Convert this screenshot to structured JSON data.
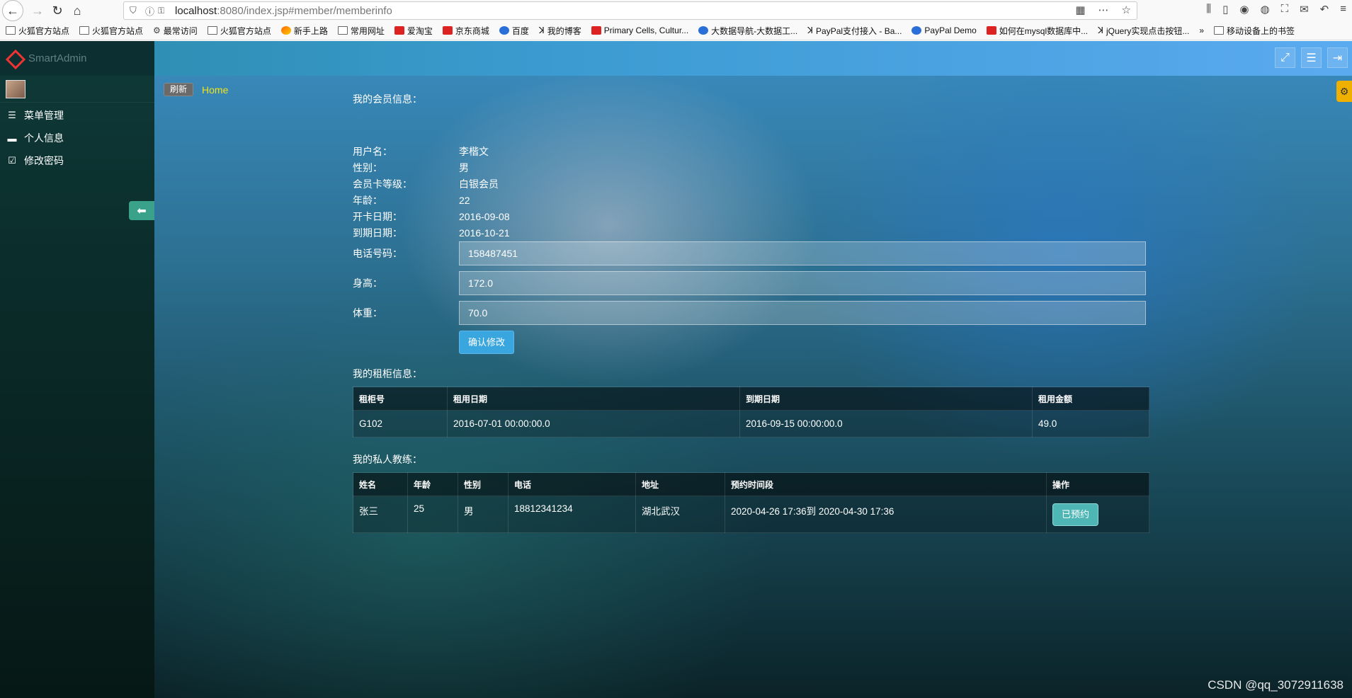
{
  "browser": {
    "url_host": "localhost",
    "url_rest": ":8080/index.jsp#member/memberinfo",
    "bookmarks": [
      {
        "label": "火狐官方站点",
        "icon": "folder-icon"
      },
      {
        "label": "火狐官方站点",
        "icon": "folder-icon"
      },
      {
        "label": "最常访问",
        "icon": "gear-icon"
      },
      {
        "label": "火狐官方站点",
        "icon": "folder-icon"
      },
      {
        "label": "新手上路",
        "icon": "firefox-icon"
      },
      {
        "label": "常用网址",
        "icon": "folder-icon"
      },
      {
        "label": "爱淘宝",
        "icon": "taobao-icon"
      },
      {
        "label": "京东商城",
        "icon": "jd-icon"
      },
      {
        "label": "百度",
        "icon": "baidu-icon"
      },
      {
        "label": "我的博客",
        "icon": "blog-icon"
      },
      {
        "label": "Primary Cells, Cultur...",
        "icon": "site-icon"
      },
      {
        "label": "大数据导航-大数据工...",
        "icon": "site-icon"
      },
      {
        "label": "PayPal支付接入 - Ba...",
        "icon": "site-icon"
      },
      {
        "label": "PayPal Demo",
        "icon": "paypal-icon"
      },
      {
        "label": "如何在mysql数据库中...",
        "icon": "csdn-icon"
      },
      {
        "label": "jQuery实现点击按钮...",
        "icon": "site-icon"
      },
      {
        "label": "移动设备上的书签",
        "icon": "mobile-icon"
      }
    ]
  },
  "app": {
    "logo_text": "SmartAdmin",
    "sidebar": {
      "items": [
        {
          "label": "菜单管理",
          "icon": "list-icon"
        },
        {
          "label": "个人信息",
          "icon": "folder-icon"
        },
        {
          "label": "修改密码",
          "icon": "checkbox-icon"
        }
      ]
    },
    "breadcrumb": {
      "refresh_label": "刷新",
      "home_label": "Home"
    }
  },
  "member": {
    "title": "我的会员信息：",
    "fields": [
      {
        "label": "用户名：",
        "value": "李楷文"
      },
      {
        "label": "性别：",
        "value": "男"
      },
      {
        "label": "会员卡等级：",
        "value": "白银会员"
      },
      {
        "label": "年龄：",
        "value": "22"
      },
      {
        "label": "开卡日期：",
        "value": "2016-09-08"
      },
      {
        "label": "到期日期：",
        "value": "2016-10-21"
      }
    ],
    "inputs": [
      {
        "label": "电话号码：",
        "value": "158487451"
      },
      {
        "label": "身高：",
        "value": "172.0"
      },
      {
        "label": "体重：",
        "value": "70.0"
      }
    ],
    "confirm_label": "确认修改"
  },
  "locker": {
    "title": "我的租柜信息：",
    "headers": [
      "租柜号",
      "租用日期",
      "到期日期",
      "租用金额"
    ],
    "rows": [
      [
        "G102",
        "2016-07-01 00:00:00.0",
        "2016-09-15 00:00:00.0",
        "49.0"
      ]
    ]
  },
  "coach": {
    "title": "我的私人教练：",
    "headers": [
      "姓名",
      "年龄",
      "性别",
      "电话",
      "地址",
      "预约时间段",
      "操作"
    ],
    "rows": [
      [
        "张三",
        "25",
        "男",
        "18812341234",
        "湖北武汉",
        "2020-04-26 17:36到 2020-04-30 17:36"
      ]
    ],
    "action_label": "已预约"
  },
  "watermark": "CSDN @qq_3072911638"
}
